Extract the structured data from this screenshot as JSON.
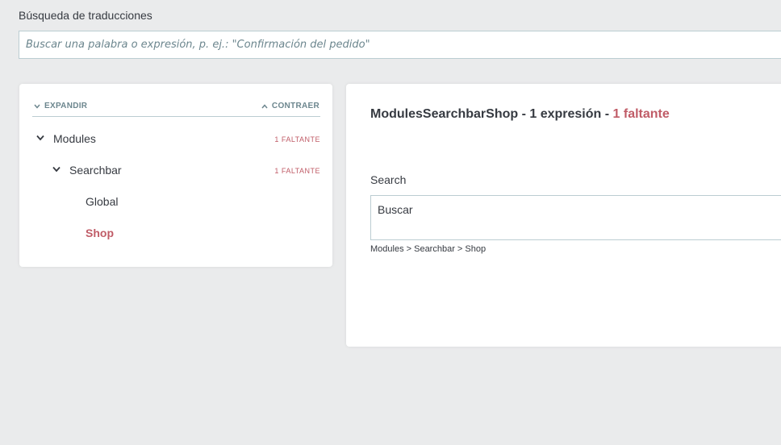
{
  "search": {
    "label": "Búsqueda de traducciones",
    "placeholder": "Buscar una palabra o expresión, p. ej.: \"Confirmación del pedido\""
  },
  "tree": {
    "expand_label": "EXPANDIR",
    "collapse_label": "CONTRAER",
    "nodes": [
      {
        "label": "Modules",
        "missing": "1 FALTANTE"
      },
      {
        "label": "Searchbar",
        "missing": "1 FALTANTE"
      },
      {
        "label": "Global",
        "missing": ""
      },
      {
        "label": "Shop",
        "missing": ""
      }
    ]
  },
  "detail": {
    "title_main": "ModulesSearchbarShop - 1 expresión - ",
    "title_missing": "1 faltante",
    "field_label": "Search",
    "field_value": "Buscar",
    "field_path": "Modules > Searchbar > Shop"
  },
  "colors": {
    "background": "#eaebec",
    "accent_missing": "#c05c67",
    "text": "#363a41",
    "border": "#bbcdd2"
  },
  "icons": [
    "chevron-down-icon",
    "chevron-up-icon"
  ]
}
